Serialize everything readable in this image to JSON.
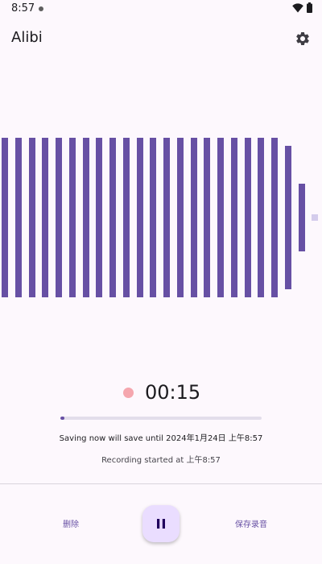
{
  "status_bar": {
    "time": "8:57",
    "icons": [
      "notification-dot-icon",
      "wifi-icon",
      "battery-icon"
    ]
  },
  "app_bar": {
    "title": "Alibi",
    "settings_icon": "gear-icon"
  },
  "recording": {
    "timer": "00:15",
    "progress_fraction": 0.01,
    "save_note": "Saving now will save until 2024年1月24日 上午8:57",
    "started_note": "Recording started at 上午8:57"
  },
  "waveform": {
    "levels": [
      1,
      1,
      1,
      1,
      1,
      1,
      1,
      1,
      1,
      1,
      1,
      1,
      1,
      1,
      1,
      1,
      1,
      1,
      1,
      1,
      1,
      0.9,
      0.42,
      0.04
    ]
  },
  "actions": {
    "delete_label": "删除",
    "pause_icon": "pause-icon",
    "save_label": "保存录音"
  },
  "colors": {
    "accent": "#6750a4",
    "record_dot": "#f5a6ae",
    "fab_background": "#eaddff",
    "background": "#fdf8fd"
  }
}
